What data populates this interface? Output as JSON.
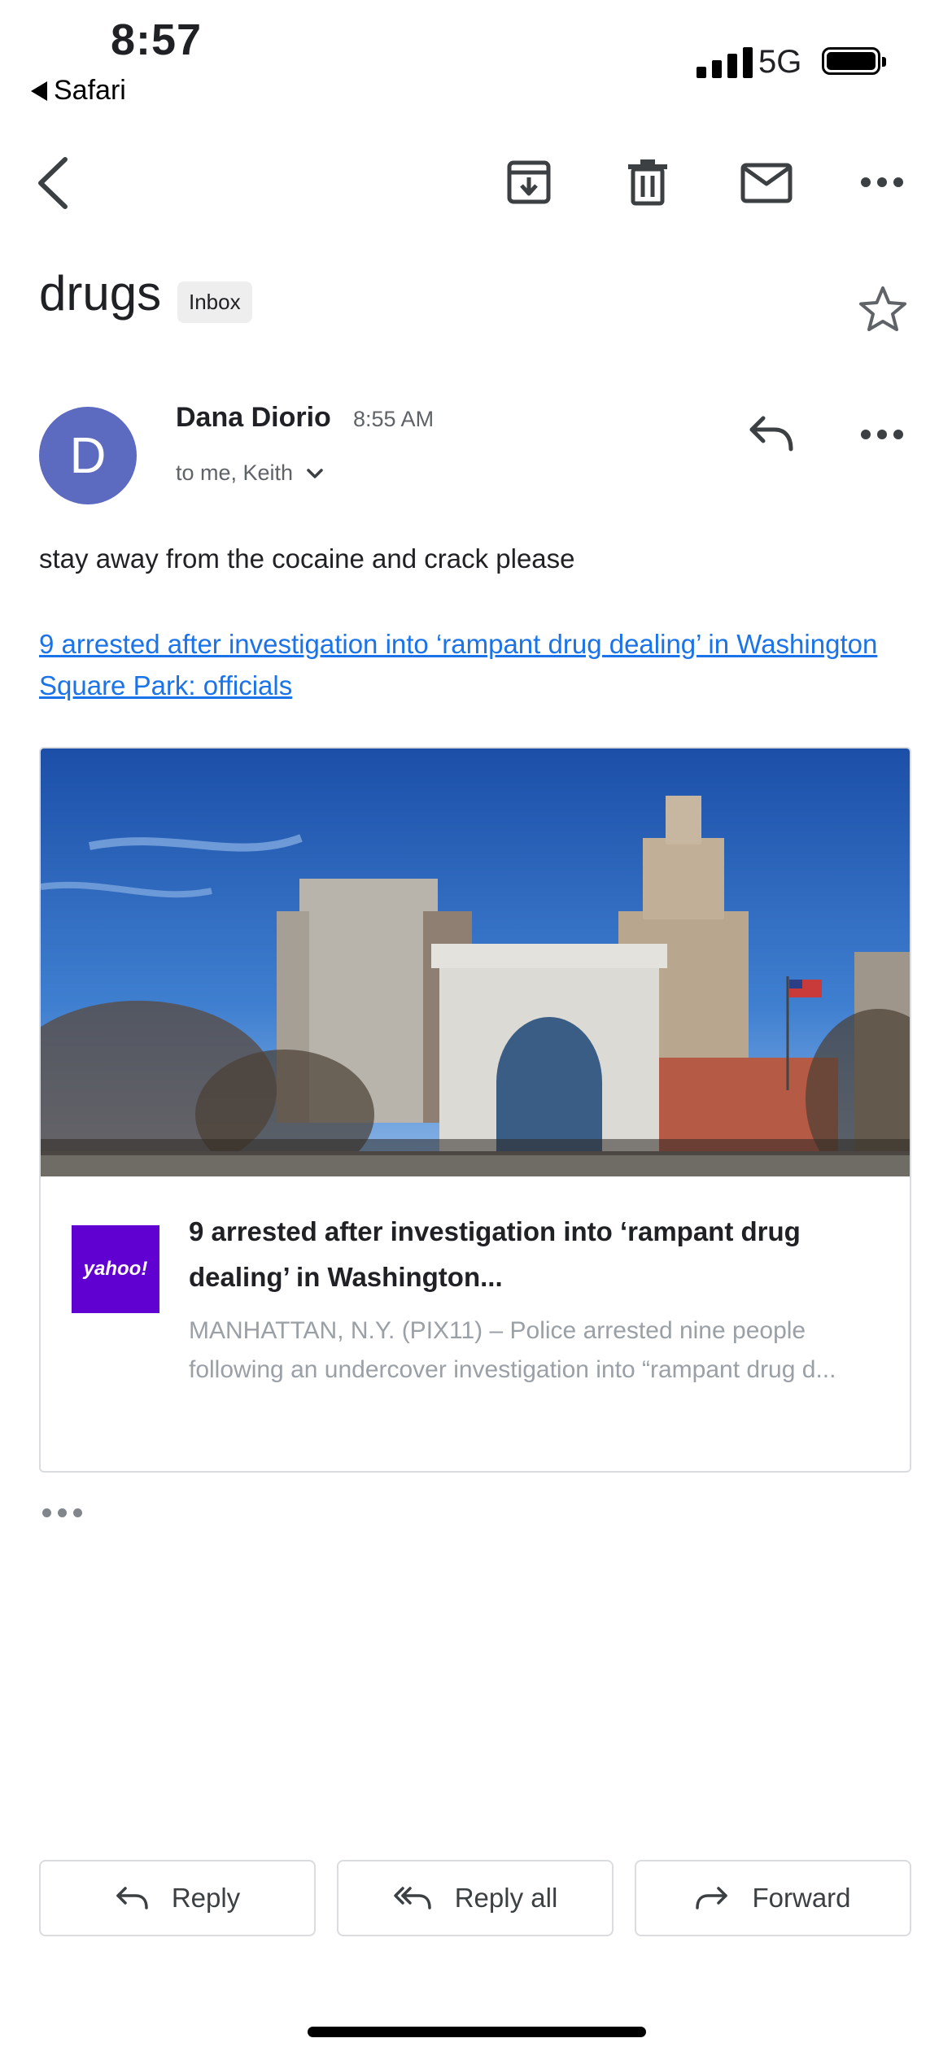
{
  "status_bar": {
    "time": "8:57",
    "back_app": "Safari",
    "network": "5G"
  },
  "toolbar": {
    "icons": [
      "back-arrow-icon",
      "archive-icon",
      "delete-icon",
      "mark-unread-icon",
      "more-icon"
    ]
  },
  "email": {
    "subject": "drugs",
    "label": "Inbox",
    "sender": {
      "initial": "D",
      "name": "Dana Diorio",
      "time": "8:55 AM",
      "recipients": "to me, Keith",
      "avatar_color": "#5c6bc0"
    },
    "body_text": "stay away from the cocaine and crack please",
    "link_text": "9 arrested after investigation into ‘rampant drug dealing’ in Washington Square Park: officials",
    "link_color": "#1a73e8",
    "preview_card": {
      "logo_text": "yahoo!",
      "logo_color": "#6001d2",
      "title": "9 arrested after investigation into ‘rampant drug dealing’ in Washington...",
      "description": "MANHATTAN, N.Y. (PIX11) – Police arrested nine people following an undercover investigation into “rampant drug d..."
    }
  },
  "actions": {
    "reply": "Reply",
    "reply_all": "Reply all",
    "forward": "Forward"
  }
}
